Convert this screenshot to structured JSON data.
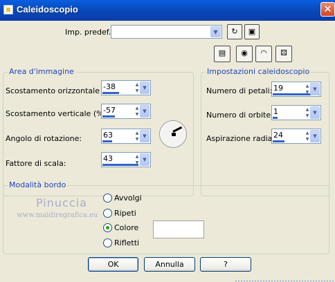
{
  "window": {
    "title": "Caleidoscopio",
    "close_label": "✕"
  },
  "preset": {
    "label": "Imp. predef.:",
    "value": ""
  },
  "group_area": {
    "title": "Area d'immagine",
    "fields": [
      {
        "label": "Scostamento orizzontale (%):",
        "value": "-38",
        "level": 0.4
      },
      {
        "label": "Scostamento verticale (%):",
        "value": "-57",
        "level": 0.3
      },
      {
        "label": "Angolo di rotazione:",
        "value": "63",
        "level": 0.2
      },
      {
        "label": "Fattore di scala:",
        "value": "43",
        "level": 0.9
      }
    ]
  },
  "group_settings": {
    "title": "Impostazioni caleidoscopio",
    "fields": [
      {
        "label": "Numero di petali:",
        "value": "19",
        "level": 1.0
      },
      {
        "label": "Numero di orbite:",
        "value": "1",
        "level": 0.1
      },
      {
        "label": "Aspirazione radiale:",
        "value": "24",
        "level": 0.25
      }
    ]
  },
  "group_border": {
    "title": "Modalità bordo",
    "options": [
      {
        "label": "Avvolgi",
        "checked": false
      },
      {
        "label": "Ripeti",
        "checked": false
      },
      {
        "label": "Colore",
        "checked": true
      },
      {
        "label": "Rifletti",
        "checked": false
      }
    ],
    "color_value": "#ffffff"
  },
  "watermark": {
    "line1": "Pinuccia",
    "line2": "www.maidiregrafica.eu"
  },
  "buttons": {
    "ok": "OK",
    "cancel": "Annulla",
    "help": "?"
  },
  "icons": [
    "reset-icon",
    "save-icon",
    "layout-icon",
    "eye-icon",
    "eye-dropper-icon",
    "dice-icon"
  ],
  "colors": {
    "title_bar": "#0a5fe0",
    "group_title": "#1f44bc",
    "accent": "#3163c4"
  }
}
